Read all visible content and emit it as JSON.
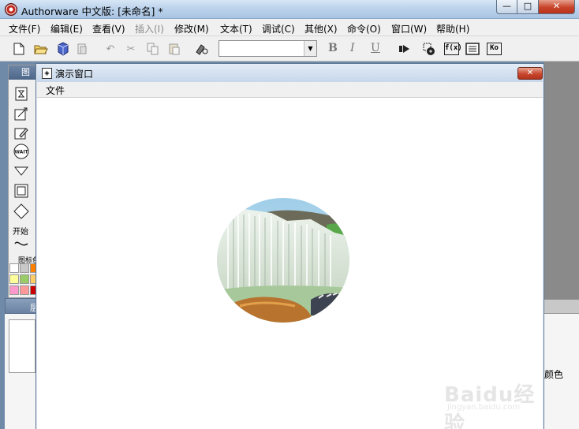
{
  "app": {
    "title": "Authorware 中文版: [未命名] *",
    "caption_buttons": {
      "minimize": "—",
      "maximize": "□",
      "close": "✕"
    }
  },
  "menubar": {
    "items": [
      {
        "label": "文件(F)",
        "enabled": true
      },
      {
        "label": "编辑(E)",
        "enabled": true
      },
      {
        "label": "查看(V)",
        "enabled": true
      },
      {
        "label": "插入(I)",
        "enabled": false
      },
      {
        "label": "修改(M)",
        "enabled": true
      },
      {
        "label": "文本(T)",
        "enabled": true
      },
      {
        "label": "调试(C)",
        "enabled": true
      },
      {
        "label": "其他(X)",
        "enabled": true
      },
      {
        "label": "命令(O)",
        "enabled": true
      },
      {
        "label": "窗口(W)",
        "enabled": true
      },
      {
        "label": "帮助(H)",
        "enabled": true
      }
    ]
  },
  "toolbar": {
    "font_combo_value": "",
    "bold": "B",
    "italic": "I",
    "underline": "U",
    "functions_glyph": "f(x)",
    "knowledge_glyph": "Ko"
  },
  "palette": {
    "title": "图",
    "start_label": "开始",
    "icon_color_label": "图标色",
    "icons": [
      "display-icon",
      "animation-icon",
      "erase-icon",
      "wait-icon",
      "decision-icon",
      "framework-icon",
      "map-icon"
    ],
    "wait_text": "WAIT",
    "swatches": [
      "#ffffff",
      "#c8c8c8",
      "#ff8000",
      "#ffff99",
      "#99cc66",
      "#ffcc66",
      "#ff99cc",
      "#ff9999",
      "#cc0000"
    ]
  },
  "layers": {
    "label": "层"
  },
  "presentation": {
    "title": "演示窗口",
    "menu_file": "文件",
    "close_glyph": "✕"
  },
  "right_panel": {
    "color_label": "颜色"
  },
  "watermark": {
    "brand": "Baidu经验",
    "url": "jingyan.baidu.com"
  },
  "colors": {
    "window_frame": "#5f7895",
    "title_gradient_top": "#d7e6f5",
    "close_red": "#c7442a"
  }
}
